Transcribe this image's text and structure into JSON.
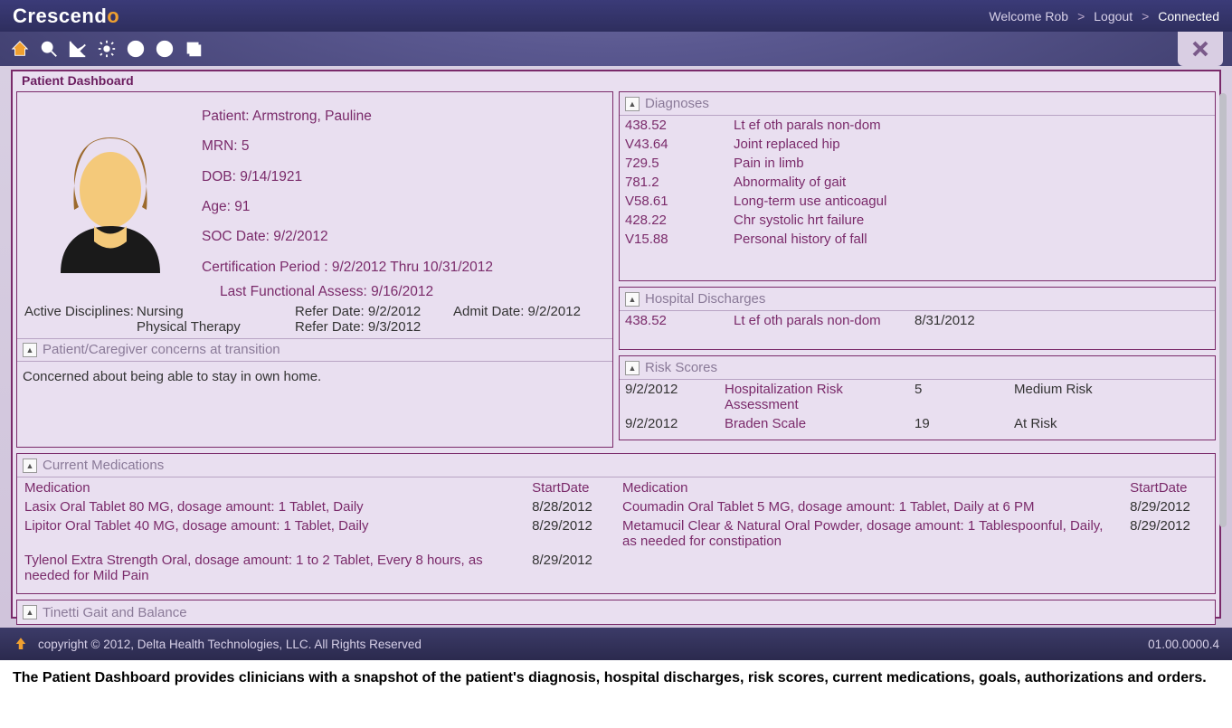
{
  "header": {
    "logo_main": "Crescend",
    "logo_o": "o",
    "welcome": "Welcome Rob",
    "sep": ">",
    "logout": "Logout",
    "connected": "Connected"
  },
  "panel_title": "Patient Dashboard",
  "patient": {
    "name_label": "Patient: Armstrong, Pauline",
    "mrn": "MRN: 5",
    "dob": "DOB: 9/14/1921",
    "age": "Age: 91",
    "soc": "SOC Date: 9/2/2012",
    "cert": "Certification Period : 9/2/2012 Thru 10/31/2012",
    "last_assess": "Last Functional Assess: 9/16/2012"
  },
  "disciplines": {
    "label": "Active Disciplines:",
    "d1": "Nursing",
    "d1_refer": "Refer Date: 9/2/2012",
    "d1_admit": "Admit Date: 9/2/2012",
    "d2": "Physical Therapy",
    "d2_refer": "Refer Date: 9/3/2012"
  },
  "concerns": {
    "title": "Patient/Caregiver concerns at transition",
    "body": "Concerned about being able to stay in own home."
  },
  "diagnoses": {
    "title": "Diagnoses",
    "rows": [
      {
        "code": "438.52",
        "desc": "Lt ef oth parals non-dom"
      },
      {
        "code": "V43.64",
        "desc": "Joint replaced hip"
      },
      {
        "code": "729.5",
        "desc": "Pain in limb"
      },
      {
        "code": "781.2",
        "desc": "Abnormality of gait"
      },
      {
        "code": "V58.61",
        "desc": "Long-term use anticoagul"
      },
      {
        "code": "428.22",
        "desc": "Chr systolic hrt failure"
      },
      {
        "code": "V15.88",
        "desc": "Personal history of fall"
      }
    ]
  },
  "discharges": {
    "title": "Hospital Discharges",
    "rows": [
      {
        "code": "438.52",
        "desc": "Lt ef oth parals non-dom",
        "date": "8/31/2012"
      }
    ]
  },
  "risk": {
    "title": "Risk Scores",
    "rows": [
      {
        "date": "9/2/2012",
        "name": "Hospitalization Risk Assessment",
        "score": "5",
        "level": "Medium Risk"
      },
      {
        "date": "9/2/2012",
        "name": "Braden Scale",
        "score": "19",
        "level": "At Risk"
      }
    ]
  },
  "meds": {
    "title": "Current Medications",
    "col_med": "Medication",
    "col_start": "StartDate",
    "left": [
      {
        "med": "Lasix Oral Tablet 80 MG,  dosage amount: 1 Tablet,  Daily",
        "start": "8/28/2012"
      },
      {
        "med": "Lipitor Oral Tablet 40 MG,  dosage amount: 1 Tablet,  Daily",
        "start": "8/29/2012"
      },
      {
        "med": "Tylenol Extra Strength Oral,  dosage amount: 1 to 2 Tablet,  Every 8 hours, as needed for Mild Pain",
        "start": "8/29/2012"
      }
    ],
    "right": [
      {
        "med": "Coumadin Oral Tablet 5 MG,  dosage amount: 1 Tablet,  Daily at 6 PM",
        "start": "8/29/2012"
      },
      {
        "med": "Metamucil Clear & Natural Oral Powder,  dosage amount: 1 Tablespoonful,  Daily, as needed for constipation",
        "start": "8/29/2012"
      }
    ]
  },
  "tinetti": {
    "title": "Tinetti Gait and Balance"
  },
  "footer": {
    "copyright": "copyright © 2012, Delta Health Technologies, LLC. All Rights Reserved",
    "version": "01.00.0000.4"
  },
  "caption": "The Patient Dashboard provides clinicians with a snapshot of the patient's diagnosis, hospital discharges, risk scores, current medications, goals, authorizations and orders."
}
